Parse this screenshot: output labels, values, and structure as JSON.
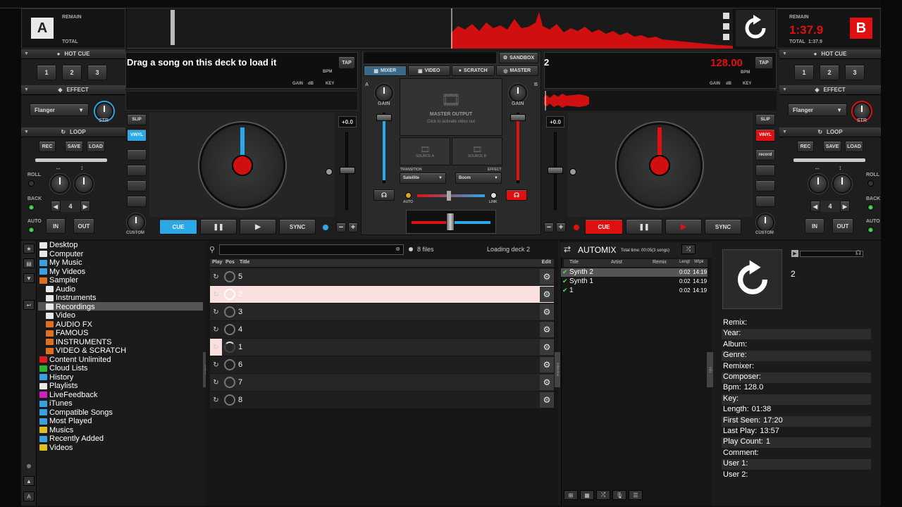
{
  "deck_a": {
    "letter": "A",
    "remain_label": "REMAIN",
    "total_label": "TOTAL",
    "hotcue_header": "HOT CUE",
    "hotcues": [
      "1",
      "2",
      "3"
    ],
    "effect_header": "EFFECT",
    "effect_name": "Flanger",
    "str_label": "STR",
    "loop_header": "LOOP",
    "loop_buttons": [
      "REC",
      "SAVE",
      "LOAD"
    ],
    "roll_label": "ROLL",
    "back_label": "BACK",
    "auto_label": "AUTO",
    "loop_size": "4",
    "in_label": "IN",
    "out_label": "OUT",
    "track_title": "Drag a song on this deck to load it",
    "bpm_label": "BPM",
    "tap_label": "TAP",
    "gain_label": "GAIN",
    "db_label": "dB",
    "key_label": "KEY",
    "slip_label": "SLIP",
    "vinyl_label": "VINYL",
    "pitch_value": "+0.0",
    "cue_label": "CUE",
    "pause_label": "❚❚",
    "play_label": "▶",
    "sync_label": "SYNC",
    "custom_label": "CUSTOM"
  },
  "deck_b": {
    "letter": "B",
    "remain_label": "REMAIN",
    "remain_time": "1:37.9",
    "total_label": "TOTAL",
    "total_time": "1:37.9",
    "hotcue_header": "HOT CUE",
    "hotcues": [
      "1",
      "2",
      "3"
    ],
    "effect_header": "EFFECT",
    "effect_name": "Flanger",
    "str_label": "STR",
    "loop_header": "LOOP",
    "loop_buttons": [
      "REC",
      "SAVE",
      "LOAD"
    ],
    "roll_label": "ROLL",
    "back_label": "BACK",
    "auto_label": "AUTO",
    "loop_size": "4",
    "in_label": "IN",
    "out_label": "OUT",
    "track_title": "2",
    "bpm_value": "128.00",
    "bpm_label": "BPM",
    "tap_label": "TAP",
    "gain_label": "GAIN",
    "db_label": "dB",
    "key_label": "KEY",
    "slip_label": "SLIP",
    "vinyl_label": "VINYL",
    "record_label": "record",
    "pitch_value": "+0.0",
    "cue_label": "CUE",
    "pause_label": "❚❚",
    "play_label": "▶",
    "sync_label": "SYNC",
    "custom_label": "CUSTOM"
  },
  "mixer": {
    "sandbox_label": "SANDBOX",
    "tabs": [
      "MIXER",
      "VIDEO",
      "SCRATCH",
      "MASTER"
    ],
    "gain_label": "GAIN",
    "master_output": "MASTER OUTPUT",
    "activate_hint": "Click to activate video out",
    "source_a": "SOURCE A",
    "source_b": "SOURCE B",
    "transition_label": "TRANSITION",
    "effect_label": "EFFECT",
    "transition_value": "Satellite",
    "effect_value": "Boom",
    "auto_label": "AUTO",
    "link_label": "LINK",
    "channel_a": "A",
    "channel_b": "B"
  },
  "browser": {
    "tree": [
      {
        "label": "Desktop",
        "indent": 0,
        "color": "#e8e8e8"
      },
      {
        "label": "Computer",
        "indent": 0,
        "color": "#e8e8e8"
      },
      {
        "label": "My Music",
        "indent": 0,
        "color": "#3aa0e0"
      },
      {
        "label": "My Videos",
        "indent": 0,
        "color": "#3aa0e0"
      },
      {
        "label": "Sampler",
        "indent": 0,
        "color": "#e07020"
      },
      {
        "label": "Audio",
        "indent": 1,
        "color": "#e8e8e8"
      },
      {
        "label": "Instruments",
        "indent": 1,
        "color": "#e8e8e8"
      },
      {
        "label": "Recordings",
        "indent": 1,
        "color": "#e8e8e8"
      },
      {
        "label": "Video",
        "indent": 1,
        "color": "#e8e8e8"
      },
      {
        "label": "AUDIO FX",
        "indent": 1,
        "color": "#e07020"
      },
      {
        "label": "FAMOUS",
        "indent": 1,
        "color": "#e07020"
      },
      {
        "label": "INSTRUMENTS",
        "indent": 1,
        "color": "#e07020"
      },
      {
        "label": "VIDEO & SCRATCH",
        "indent": 1,
        "color": "#e07020"
      },
      {
        "label": "Content Unlimited",
        "indent": 0,
        "color": "#e02020"
      },
      {
        "label": "Cloud Lists",
        "indent": 0,
        "color": "#30b030"
      },
      {
        "label": "History",
        "indent": 0,
        "color": "#3aa0e0"
      },
      {
        "label": "Playlists",
        "indent": 0,
        "color": "#e8e8e8"
      },
      {
        "label": "LiveFeedback",
        "indent": 0,
        "color": "#d020c0"
      },
      {
        "label": "iTunes",
        "indent": 0,
        "color": "#3aa0e0"
      },
      {
        "label": "Compatible Songs",
        "indent": 0,
        "color": "#3aa0e0"
      },
      {
        "label": "Most Played",
        "indent": 0,
        "color": "#3aa0e0"
      },
      {
        "label": "Musics",
        "indent": 0,
        "color": "#e0c020"
      },
      {
        "label": "Recently Added",
        "indent": 0,
        "color": "#3aa0e0"
      },
      {
        "label": "Videos",
        "indent": 0,
        "color": "#e0c020"
      }
    ],
    "search_placeholder": "",
    "file_count": "8 files",
    "status": "Loading deck 2",
    "columns": {
      "play": "Play",
      "pos": "Pos",
      "title": "Title",
      "edit": "Edit"
    },
    "rows": [
      "5",
      "2",
      "3",
      "4",
      "1",
      "6",
      "7",
      "8"
    ],
    "left_tab": "folders",
    "right_tab": "sideview"
  },
  "automix": {
    "title": "AUTOMIX",
    "total_time": "Total time: 00:05(3 songs)",
    "columns": [
      "Title",
      "Artist",
      "Remix",
      "Lengt",
      "Wtpk"
    ],
    "rows": [
      {
        "title": "Synth 2",
        "length": "0:02",
        "wtpk": "14:19"
      },
      {
        "title": "Synth 1",
        "length": "0:02",
        "wtpk": "14:19"
      },
      {
        "title": "1",
        "length": "0:02",
        "wtpk": "14:19"
      }
    ],
    "info_tab": "info"
  },
  "info": {
    "title": "2",
    "fields": [
      {
        "k": "Remix:",
        "v": ""
      },
      {
        "k": "Year:",
        "v": ""
      },
      {
        "k": "Album:",
        "v": ""
      },
      {
        "k": "Genre:",
        "v": ""
      },
      {
        "k": "Remixer:",
        "v": ""
      },
      {
        "k": "Composer:",
        "v": ""
      },
      {
        "k": "Bpm:",
        "v": "128.0"
      },
      {
        "k": "Key:",
        "v": ""
      },
      {
        "k": "Length:",
        "v": "01:38"
      },
      {
        "k": "First Seen:",
        "v": "17:20"
      },
      {
        "k": "Last Play:",
        "v": "13:57"
      },
      {
        "k": "Play Count:",
        "v": "1"
      },
      {
        "k": "Comment:",
        "v": ""
      },
      {
        "k": "User 1:",
        "v": ""
      },
      {
        "k": "User 2:",
        "v": ""
      }
    ]
  },
  "colors": {
    "accent_red": "#e01010",
    "accent_blue": "#2aa8e8",
    "bg": "#1b1b1b"
  }
}
